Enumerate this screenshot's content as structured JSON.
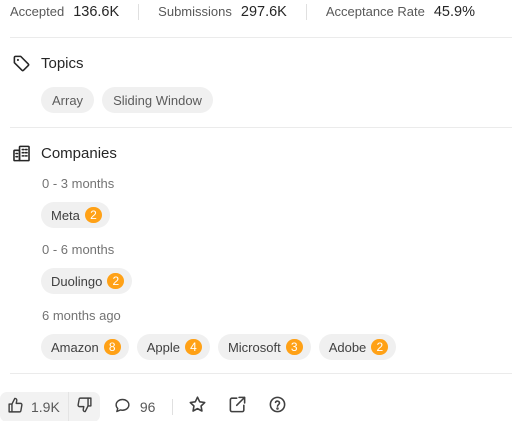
{
  "stats": {
    "accepted_label": "Accepted",
    "accepted_value": "136.6K",
    "submissions_label": "Submissions",
    "submissions_value": "297.6K",
    "rate_label": "Acceptance Rate",
    "rate_value": "45.9%"
  },
  "topics": {
    "title": "Topics",
    "icon": "tag-icon",
    "items": [
      "Array",
      "Sliding Window"
    ]
  },
  "companies": {
    "title": "Companies",
    "icon": "building-icon",
    "groups": [
      {
        "label": "0 - 3 months",
        "items": [
          {
            "name": "Meta",
            "count": "2"
          }
        ]
      },
      {
        "label": "0 - 6 months",
        "items": [
          {
            "name": "Duolingo",
            "count": "2"
          }
        ]
      },
      {
        "label": "6 months ago",
        "items": [
          {
            "name": "Amazon",
            "count": "8"
          },
          {
            "name": "Apple",
            "count": "4"
          },
          {
            "name": "Microsoft",
            "count": "3"
          },
          {
            "name": "Adobe",
            "count": "2"
          }
        ]
      }
    ]
  },
  "footer": {
    "likes": "1.9K",
    "comments": "96"
  },
  "colors": {
    "badge": "#ffa116",
    "chip_bg": "#f0f0f0"
  }
}
